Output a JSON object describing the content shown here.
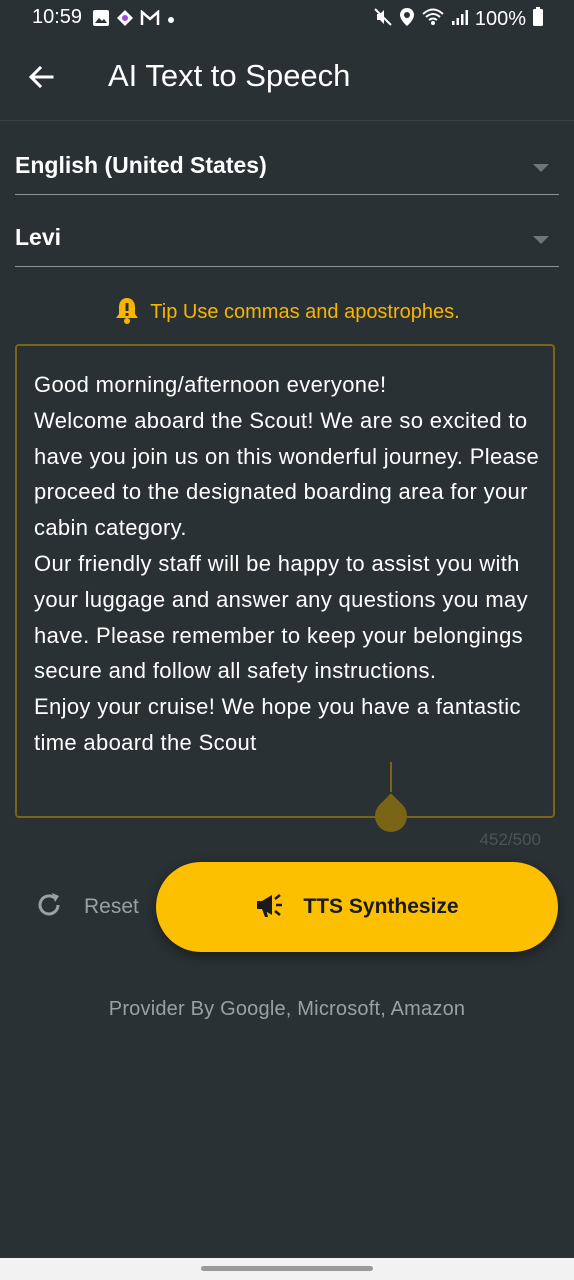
{
  "status_bar": {
    "time": "10:59",
    "battery": "100%",
    "left_icons": [
      "image-icon",
      "messenger-icon",
      "gmail-icon",
      "dot-icon"
    ],
    "right_icons": [
      "mute-icon",
      "location-icon",
      "wifi-icon",
      "signal-icon",
      "battery-icon"
    ]
  },
  "app_bar": {
    "title": "AI Text to Speech",
    "back_icon": "arrow-left-icon"
  },
  "language_dropdown": {
    "value": "English (United States)"
  },
  "voice_dropdown": {
    "value": "Levi"
  },
  "tip": {
    "icon": "bell-warning-icon",
    "text": "Tip Use commas and apostrophes."
  },
  "text_input": {
    "value": "Good morning/afternoon everyone!\nWelcome aboard the Scout! We are so excited to have you join us on this wonderful journey. Please proceed to the designated boarding area for your cabin category.\nOur friendly staff will be happy to assist you with your luggage and answer any questions you may have. Please remember to keep your belongings secure and follow all safety instructions.\nEnjoy your cruise! We hope you have a fantastic time aboard the Scout",
    "counter": "452/500"
  },
  "actions": {
    "reset_label": "Reset",
    "reset_icon": "refresh-icon",
    "synthesize_label": "TTS Synthesize",
    "synthesize_icon": "megaphone-icon"
  },
  "footer": {
    "provider_text": "Provider By Google, Microsoft, Amazon"
  },
  "colors": {
    "background": "#2a3135",
    "accent": "#fcc000",
    "tip_text": "#f7b500",
    "border": "#7a6516"
  }
}
